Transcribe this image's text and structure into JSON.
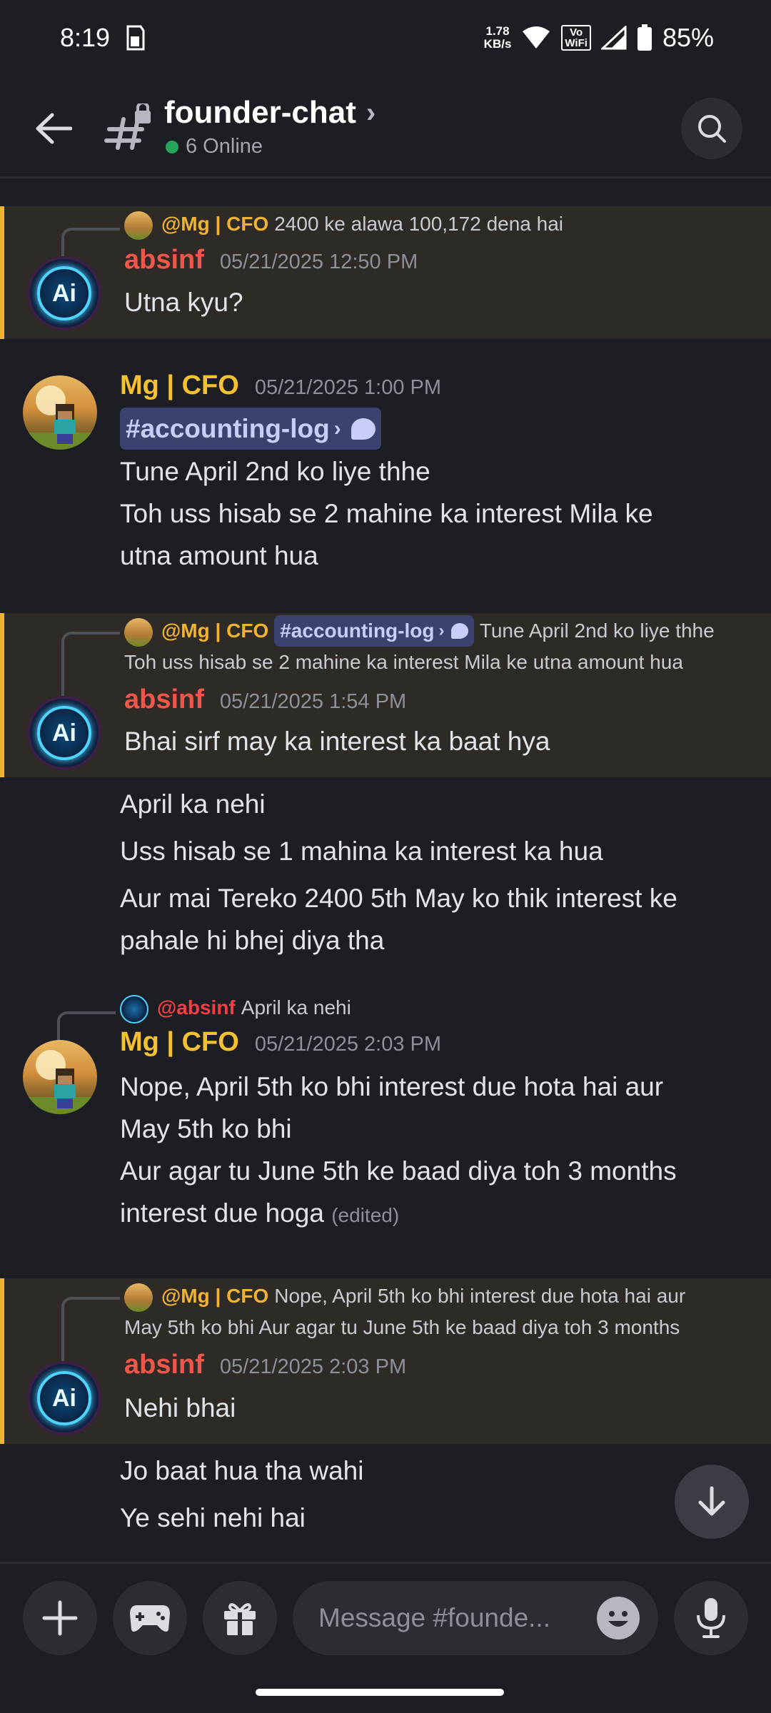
{
  "status_bar": {
    "time": "8:19",
    "net_speed_value": "1.78",
    "net_speed_unit": "KB/s",
    "vowifi_top": "Vo",
    "vowifi_bottom": "WiFi",
    "battery": "85%"
  },
  "header": {
    "channel_name": "founder-chat",
    "online": "6 Online",
    "chevron": "›"
  },
  "messages": [
    {
      "reply_to": "@Mg | CFO",
      "reply_text": "2400 ke alawa 100,172 dena hai",
      "author": "absinf",
      "timestamp": "05/21/2025 12:50 PM",
      "lines": [
        "Utna kyu?"
      ]
    },
    {
      "author": "Mg | CFO",
      "timestamp": "05/21/2025 1:00 PM",
      "channel_mention": "#accounting-log",
      "lines": [
        "Tune April 2nd ko liye thhe",
        "Toh uss hisab se 2 mahine ka interest Mila ke",
        "utna amount hua"
      ]
    },
    {
      "reply_to": "@Mg | CFO",
      "reply_channel": "#accounting-log",
      "reply_text_1": "Tune April 2nd ko liye thhe",
      "reply_text_2": "Toh uss hisab se 2 mahine ka interest Mila ke utna amount hua",
      "author": "absinf",
      "timestamp": "05/21/2025 1:54 PM",
      "lines": [
        "Bhai sirf may ka interest ka baat hya",
        "April ka nehi",
        "Uss hisab se 1 mahina ka interest ka hua",
        "Aur mai Tereko 2400 5th May ko thik interest ke",
        "pahale hi bhej diya tha"
      ]
    },
    {
      "reply_to": "@absinf",
      "reply_text": "April ka nehi",
      "author": "Mg | CFO",
      "timestamp": "05/21/2025 2:03 PM",
      "lines": [
        "Nope, April 5th ko bhi interest due hota hai aur",
        "May 5th ko bhi",
        "Aur agar tu June 5th ke baad diya toh 3 months",
        "interest due hoga"
      ],
      "edited": "(edited)"
    },
    {
      "reply_to": "@Mg | CFO",
      "reply_text_1": "Nope, April 5th ko bhi interest due hota hai aur",
      "reply_text_2": "May 5th ko bhi Aur agar tu June 5th ke baad diya toh 3 months",
      "author": "absinf",
      "timestamp": "05/21/2025 2:03 PM",
      "lines": [
        "Nehi bhai",
        "Jo baat hua tha wahi",
        "Ye sehi nehi hai"
      ]
    }
  ],
  "composer": {
    "placeholder": "Message #founde..."
  },
  "colors": {
    "background": "#1d1e23",
    "highlight_bg": "#2e2b27",
    "highlight_border": "#f0b232",
    "author_absinf": "#f0564a",
    "author_mg": "#f5c12e",
    "online": "#23a55a"
  },
  "icons": [
    "back-arrow-icon",
    "channel-hash-lock-icon",
    "search-icon",
    "plus-icon",
    "gamepad-icon",
    "gift-icon",
    "emoji-icon",
    "microphone-icon",
    "arrow-down-icon"
  ]
}
